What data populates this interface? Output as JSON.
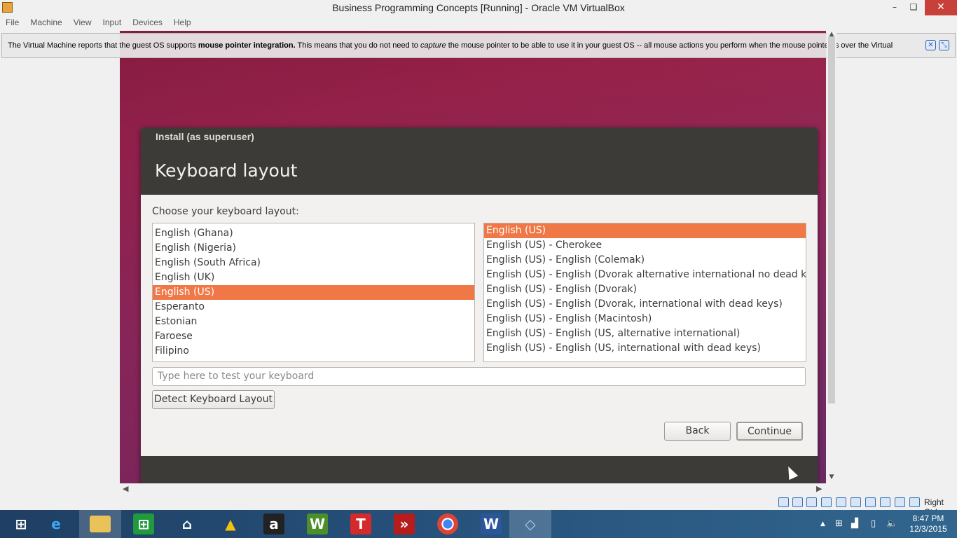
{
  "window": {
    "title": "Business Programming Concepts [Running] - Oracle VM VirtualBox",
    "minimize": "–",
    "restore": "❏",
    "close": "✕"
  },
  "menubar": [
    "File",
    "Machine",
    "View",
    "Input",
    "Devices",
    "Help"
  ],
  "notification": {
    "text_before": "The Virtual Machine reports that the guest OS supports ",
    "bold": "mouse pointer integration.",
    "text_mid": " This means that you do not need to ",
    "italic": "capture",
    "text_after": " the mouse pointer to be able to use it in your guest OS -- all mouse actions you perform when the mouse pointer is over the Virtual"
  },
  "installer": {
    "caption": "Install (as superuser)",
    "heading": "Keyboard layout",
    "choose_label": "Choose your keyboard layout:",
    "layouts": [
      "English (Ghana)",
      "English (Nigeria)",
      "English (South Africa)",
      "English (UK)",
      "English (US)",
      "Esperanto",
      "Estonian",
      "Faroese",
      "Filipino"
    ],
    "selected_layout": "English (US)",
    "variants": [
      "English (US)",
      "English (US) - Cherokee",
      "English (US) - English (Colemak)",
      "English (US) - English (Dvorak alternative international no dead keys)",
      "English (US) - English (Dvorak)",
      "English (US) - English (Dvorak, international with dead keys)",
      "English (US) - English (Macintosh)",
      "English (US) - English (US, alternative international)",
      "English (US) - English (US, international with dead keys)"
    ],
    "selected_variant": "English (US)",
    "test_placeholder": "Type here to test your keyboard",
    "detect_button": "Detect Keyboard Layout",
    "back_button": "Back",
    "continue_button": "Continue"
  },
  "statusbar": {
    "host_key": "Right Ctrl"
  },
  "taskbar": {
    "apps": [
      "start",
      "internet-explorer",
      "file-explorer",
      "store",
      "home",
      "google-drive",
      "amazon",
      "webex",
      "t-app",
      "double-arrow-app",
      "chrome",
      "word",
      "virtualbox"
    ],
    "time": "8:47 PM",
    "date": "12/3/2015"
  },
  "colors": {
    "selection": "#f07746",
    "dialog_header": "#3c3b37",
    "taskbar": "#254f78",
    "close_button": "#c7403a"
  }
}
